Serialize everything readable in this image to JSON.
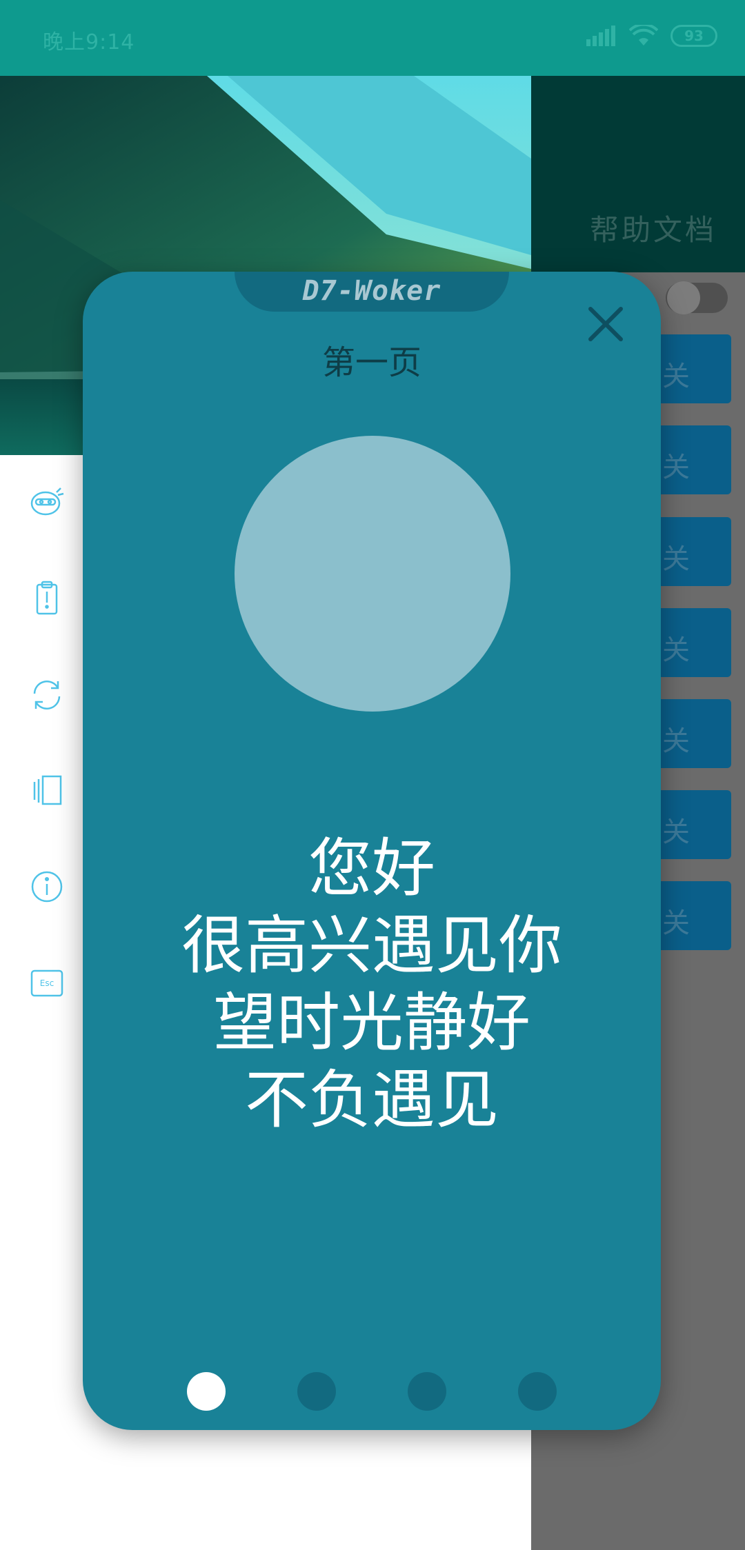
{
  "status_bar": {
    "time": "晚上9:14",
    "battery": "93"
  },
  "right_panel": {
    "help_label": "帮助文档",
    "button_label": "关"
  },
  "dialog": {
    "brand": "D7-Woker",
    "page_title": "第一页",
    "greeting_lines": [
      "您好",
      "很高兴遇见你",
      "望时光静好",
      "不负遇见"
    ],
    "pager": {
      "count": 4,
      "active_index": 0
    }
  },
  "left_icons": [
    "ninja-icon",
    "alert-clipboard-icon",
    "refresh-icon",
    "pages-icon",
    "info-icon",
    "esc-icon"
  ],
  "colors": {
    "accent": "#198297",
    "status_bar": "#0e9a8e",
    "dark_teal": "#013a36",
    "button_blue": "#0a5f8a"
  }
}
